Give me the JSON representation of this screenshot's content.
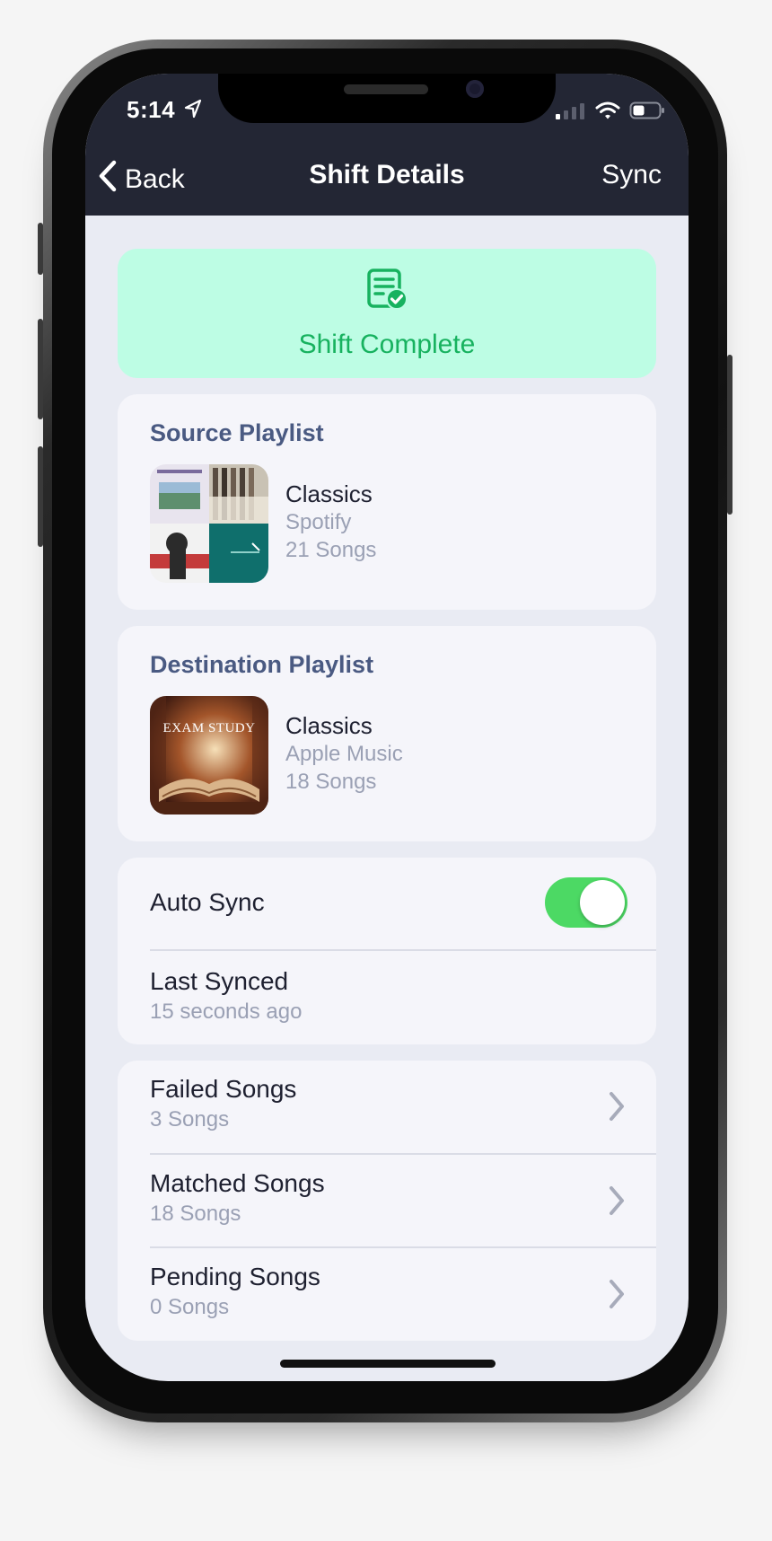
{
  "status_bar": {
    "time": "5:14"
  },
  "nav": {
    "back_label": "Back",
    "title": "Shift Details",
    "sync_label": "Sync"
  },
  "banner": {
    "icon": "checklist-check-icon",
    "title": "Shift Complete"
  },
  "source": {
    "heading": "Source Playlist",
    "name": "Classics",
    "service": "Spotify",
    "count": "21 Songs"
  },
  "destination": {
    "heading": "Destination Playlist",
    "name": "Classics",
    "service": "Apple Music",
    "count": "18 Songs",
    "art_text": "EXAM STUDY"
  },
  "sync": {
    "auto_label": "Auto Sync",
    "auto_enabled": true,
    "last_label": "Last Synced",
    "last_value": "15 seconds ago"
  },
  "songs": [
    {
      "label": "Failed Songs",
      "count": "3 Songs"
    },
    {
      "label": "Matched Songs",
      "count": "18 Songs"
    },
    {
      "label": "Pending Songs",
      "count": "0 Songs"
    }
  ],
  "colors": {
    "nav_bg": "#232634",
    "success": "#17b25f",
    "banner_bg": "#bdfde4",
    "toggle_on": "#4cd964",
    "heading": "#4a5a82"
  }
}
